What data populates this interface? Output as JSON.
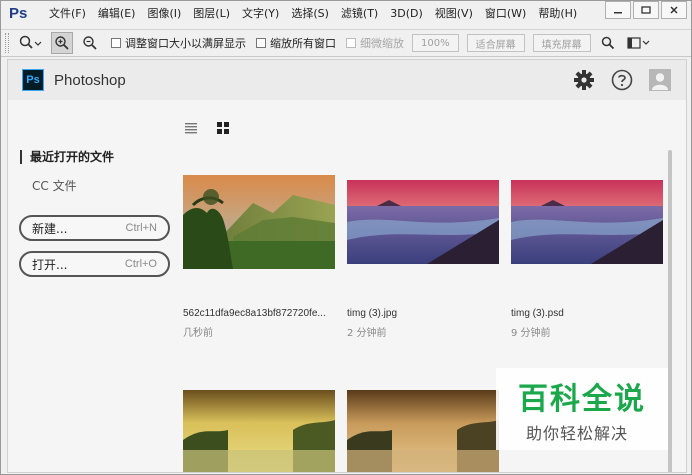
{
  "menubar": {
    "app_glyph": "Ps",
    "items": [
      "文件(F)",
      "编辑(E)",
      "图像(I)",
      "图层(L)",
      "文字(Y)",
      "选择(S)",
      "滤镜(T)",
      "3D(D)",
      "视图(V)",
      "窗口(W)",
      "帮助(H)"
    ],
    "window_controls": [
      "minimize-icon",
      "restore-icon",
      "close-icon"
    ]
  },
  "options_bar": {
    "check_resize_windows": "调整窗口大小以满屏显示",
    "check_zoom_all": "缩放所有窗口",
    "check_scrubby_zoom": "细微缩放",
    "btn_100": "100%",
    "btn_fit": "适合屏幕",
    "btn_fill": "填充屏幕"
  },
  "workspace": {
    "title": "Photoshop",
    "logo_glyph": "Ps",
    "header_icons": [
      "gear-icon",
      "help-icon",
      "user-avatar-icon"
    ],
    "recent_label": "最近打开的文件",
    "cc_label": "CC 文件",
    "new_button": {
      "label": "新建...",
      "shortcut": "Ctrl+N"
    },
    "open_button": {
      "label": "打开...",
      "shortcut": "Ctrl+O"
    },
    "view_toggles": [
      "list-view-icon",
      "grid-view-icon"
    ],
    "files": [
      {
        "name": "562c11dfa9ec8a13bf872720fe...",
        "time": "几秒前"
      },
      {
        "name": "timg (3).jpg",
        "time": "2 分钟前"
      },
      {
        "name": "timg (3).psd",
        "time": "9 分钟前"
      }
    ]
  },
  "watermark": {
    "line1": "百科全说",
    "line2": "助你轻松解决"
  },
  "colors": {
    "ps_blue": "#31a8ff",
    "ps_dark": "#001d26",
    "watermark_green": "#1aa84b"
  }
}
